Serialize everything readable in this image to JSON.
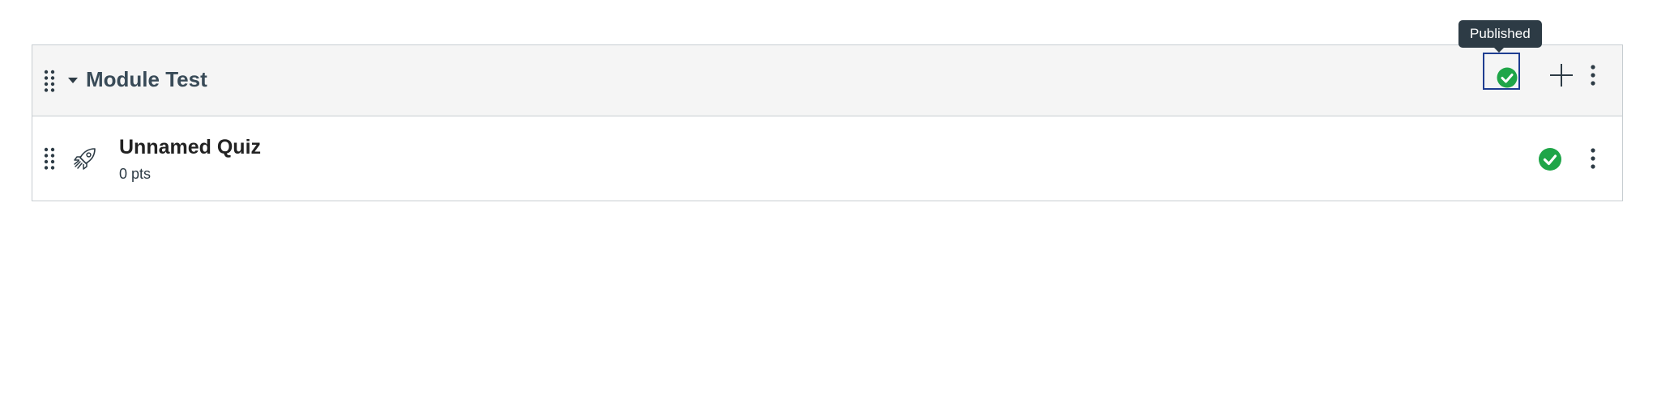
{
  "tooltip": {
    "text": "Published"
  },
  "module": {
    "title": "Module Test",
    "status": "published",
    "icons": {
      "drag": "drag-handle-icon",
      "collapse": "caret-down-icon",
      "publish": "published-check-icon",
      "add": "plus-icon",
      "menu": "kebab-menu-icon"
    },
    "items": [
      {
        "title": "Unnamed Quiz",
        "points": "0 pts",
        "type_icon": "rocket-icon",
        "status": "published"
      }
    ]
  },
  "colors": {
    "published_green": "#1fa548",
    "focus_ring": "#1f3d91",
    "header_bg": "#f5f5f5",
    "tooltip_bg": "#2d3b45"
  }
}
